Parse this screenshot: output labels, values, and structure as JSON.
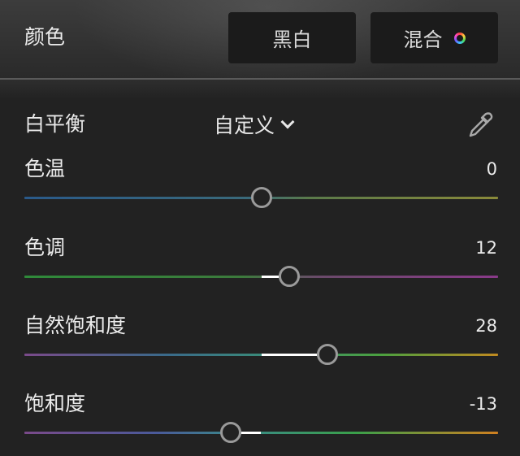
{
  "header": {
    "title": "颜色",
    "bw_label": "黑白",
    "mix_label": "混合",
    "mix_icon": "color-wheel-icon"
  },
  "white_balance": {
    "label": "白平衡",
    "value": "自定义",
    "dropdown_icon": "chevron-down-icon",
    "picker_icon": "eyedropper-icon"
  },
  "sliders": [
    {
      "label": "色温",
      "value": "0",
      "num": 0,
      "min": -100,
      "max": 100
    },
    {
      "label": "色调",
      "value": "12",
      "num": 12,
      "min": -100,
      "max": 100
    },
    {
      "label": "自然饱和度",
      "value": "28",
      "num": 28,
      "min": -100,
      "max": 100
    },
    {
      "label": "饱和度",
      "value": "-13",
      "num": -13,
      "min": -100,
      "max": 100
    }
  ],
  "colors": {
    "background": "#222222",
    "button_bg": "#1b1b1b",
    "thumb_border": "#9a9a9a",
    "fill": "#ffffff"
  }
}
